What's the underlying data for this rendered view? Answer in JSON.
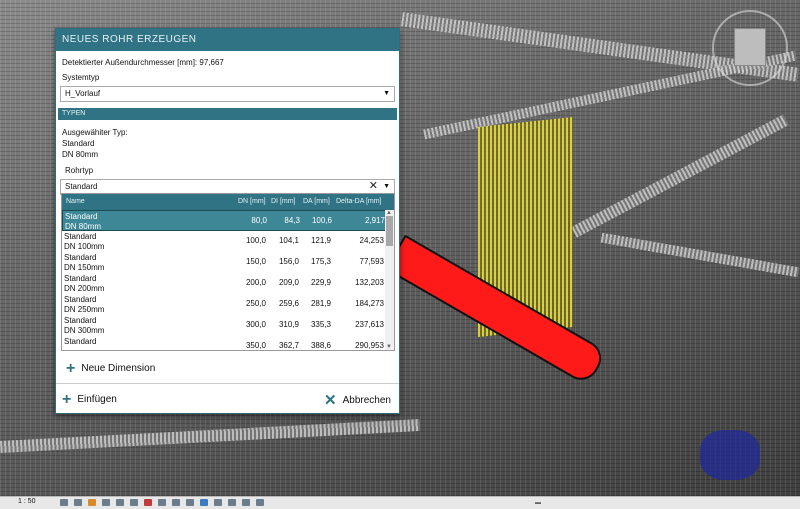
{
  "dialog": {
    "title": "NEUES ROHR ERZEUGEN",
    "detected_diameter": "Detektierter Außendurchmesser [mm]: 97,667",
    "system_type_label": "Systemtyp",
    "system_type_value": "H_Vorlauf",
    "types_section": "TYPEN",
    "selected_type_label": "Ausgewähiter Typ:",
    "selected_type_name": "Standard",
    "selected_type_dn": "DN 80mm",
    "pipe_type_label": "Rohrtyp",
    "pipe_type_value": "Standard",
    "columns": [
      "Name",
      "DN [mm]",
      "DI [mm]",
      "DA [mm]",
      "Delta-DA [mm]"
    ],
    "rows": [
      {
        "name": "Standard",
        "sub": "DN 80mm",
        "dn": "80,0",
        "di": "84,3",
        "da": "100,6",
        "delta": "2,917"
      },
      {
        "name": "Standard",
        "sub": "DN 100mm",
        "dn": "100,0",
        "di": "104,1",
        "da": "121,9",
        "delta": "24,253"
      },
      {
        "name": "Standard",
        "sub": "DN 150mm",
        "dn": "150,0",
        "di": "156,0",
        "da": "175,3",
        "delta": "77,593"
      },
      {
        "name": "Standard",
        "sub": "DN 200mm",
        "dn": "200,0",
        "di": "209,0",
        "da": "229,9",
        "delta": "132,203"
      },
      {
        "name": "Standard",
        "sub": "DN 250mm",
        "dn": "250,0",
        "di": "259,6",
        "da": "281,9",
        "delta": "184,273"
      },
      {
        "name": "Standard",
        "sub": "DN 300mm",
        "dn": "300,0",
        "di": "310,9",
        "da": "335,3",
        "delta": "237,613"
      },
      {
        "name": "Standard",
        "sub": "",
        "dn": "350,0",
        "di": "362,7",
        "da": "388,6",
        "delta": "290,953"
      }
    ],
    "new_dimension_label": "Neue Dimension",
    "insert_label": "Einfügen",
    "cancel_label": "Abbrechen"
  },
  "statusbar": {
    "scale": "1 : 50"
  },
  "icons": {
    "add": "plus-icon",
    "cancel": "close-icon",
    "clear": "clear-x-icon",
    "dropdown": "chevron-down-icon"
  },
  "colors": {
    "accent": "#2f7384",
    "selected_row": "#3d8796",
    "pipe": "#ff1a1a",
    "pointcloud_yellow": "#e6dc3c"
  }
}
